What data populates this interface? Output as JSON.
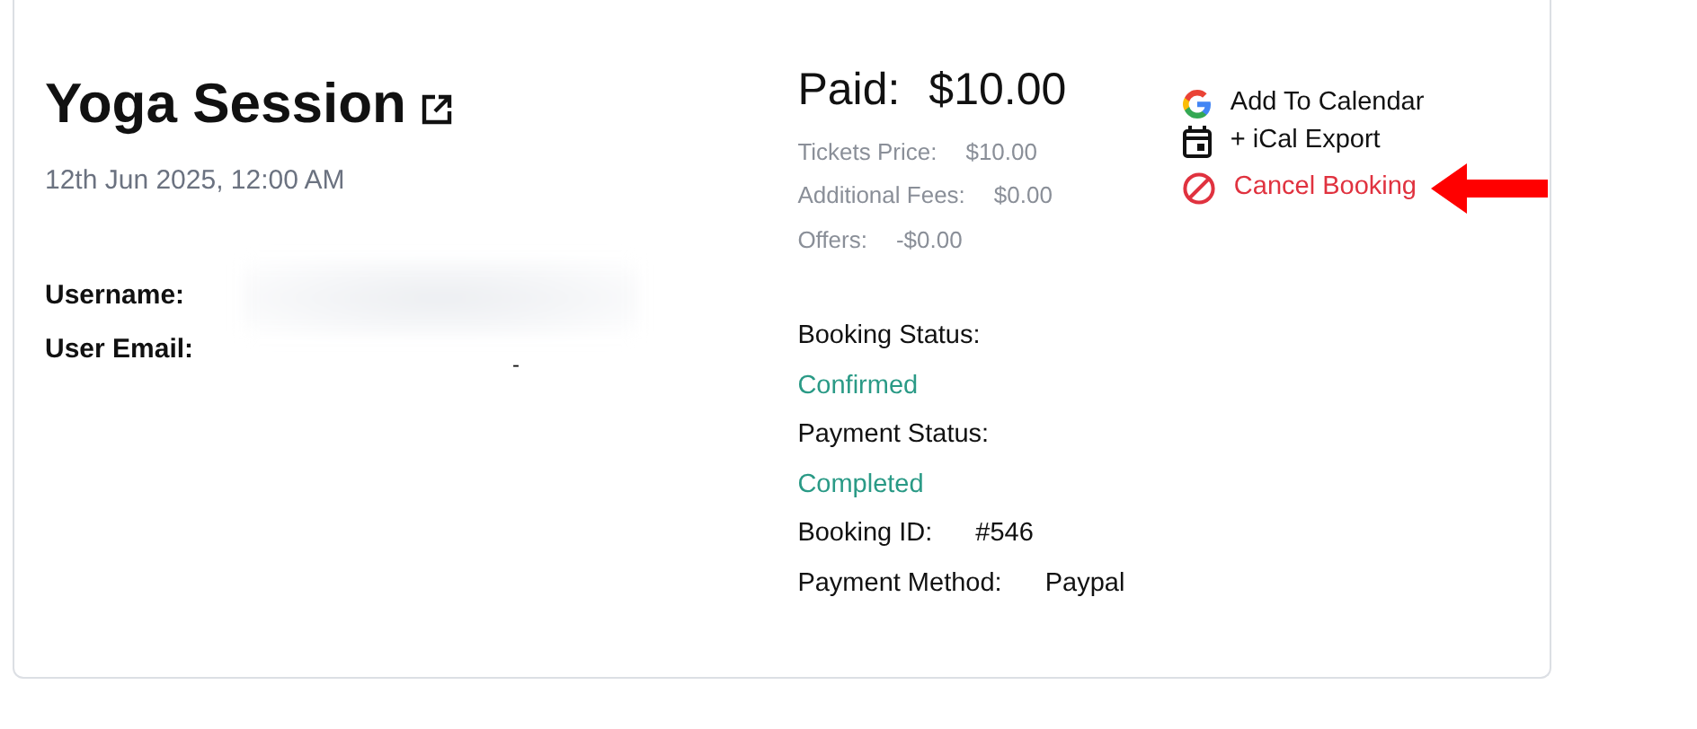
{
  "event": {
    "title": "Yoga Session",
    "datetime": "12th Jun 2025, 12:00 AM"
  },
  "user_fields": [
    {
      "label": "Username:",
      "kind": "blurred"
    },
    {
      "label": "User Email:",
      "kind": "text",
      "value": "-"
    }
  ],
  "payment": {
    "label": "Paid:",
    "amount": "$10.00",
    "breakdown": [
      {
        "label": "Tickets Price:",
        "value": "$10.00"
      },
      {
        "label": "Additional Fees:",
        "value": "$0.00"
      },
      {
        "label": "Offers:",
        "value": "-$0.00"
      }
    ]
  },
  "booking_fields": [
    {
      "label": "Booking Status:",
      "value": "Confirmed",
      "kind": "status"
    },
    {
      "label": "Payment Status:",
      "value": "Completed",
      "kind": "status"
    },
    {
      "label": "Booking ID:",
      "value": "#546",
      "kind": "inline"
    },
    {
      "label": "Payment Method:",
      "value": "Paypal",
      "kind": "inline"
    }
  ],
  "actions": [
    {
      "label": "Add To Calendar",
      "kind": "google"
    },
    {
      "label": "+ iCal Export",
      "kind": "calendar"
    },
    {
      "label": "Cancel Booking",
      "kind": "cancel",
      "highlighted": true
    }
  ]
}
